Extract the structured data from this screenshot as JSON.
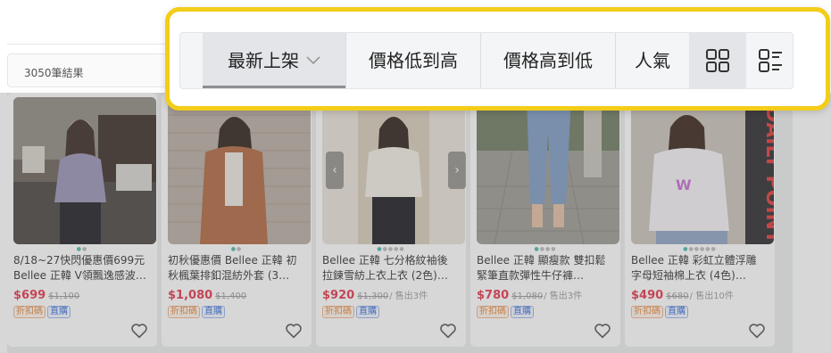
{
  "results": {
    "count_label": "3050筆結果"
  },
  "sort_bar": {
    "items": [
      {
        "label": "最新上架",
        "active": true
      },
      {
        "label": "價格低到高",
        "active": false
      },
      {
        "label": "價格高到低",
        "active": false
      },
      {
        "label": "人氣",
        "active": false
      }
    ],
    "views": [
      {
        "icon": "grid-view-icon",
        "active": true
      },
      {
        "icon": "list-view-icon",
        "active": false
      }
    ],
    "highlight_color": "#f3cd18"
  },
  "products": [
    {
      "title_1": "8/18~27快閃優惠價699元",
      "title_2": "Bellee 正韓 V領飄逸感波…",
      "price": "$699",
      "original_price": "$1,100",
      "sold": "",
      "tags": [
        "折扣碼",
        "直購"
      ]
    },
    {
      "title_1": "初秋優惠價 Bellee 正韓 初",
      "title_2": "秋楓葉排釦混紡外套 (3…",
      "price": "$1,080",
      "original_price": "$1,400",
      "sold": "",
      "tags": [
        "折扣碼",
        "直購"
      ]
    },
    {
      "title_1": "Bellee 正韓 七分格紋袖後",
      "title_2": "拉鍊雪紡上衣上衣 (2色)…",
      "price": "$920",
      "original_price": "$1,300",
      "sold": "/ 售出3件",
      "tags": [
        "折扣碼",
        "直購"
      ]
    },
    {
      "title_1": "Bellee 正韓 顯瘦款 雙扣鬆",
      "title_2": "緊筆直款彈性牛仔褲…",
      "price": "$780",
      "original_price": "$1,080",
      "sold": "/ 售出3件",
      "tags": [
        "折扣碼",
        "直購"
      ]
    },
    {
      "title_1": "Bellee 正韓 彩虹立體浮雕",
      "title_2": "字母短袖棉上衣 (4色)…",
      "price": "$490",
      "original_price": "$680",
      "sold": "/ 售出10件",
      "tags": [
        "折扣碼",
        "直購"
      ]
    }
  ],
  "carousel": {
    "prev_icon": "chevron-left-icon",
    "next_icon": "chevron-right-icon"
  },
  "colors": {
    "price": "#e3364c",
    "accent_dot": "#48b7a8"
  }
}
